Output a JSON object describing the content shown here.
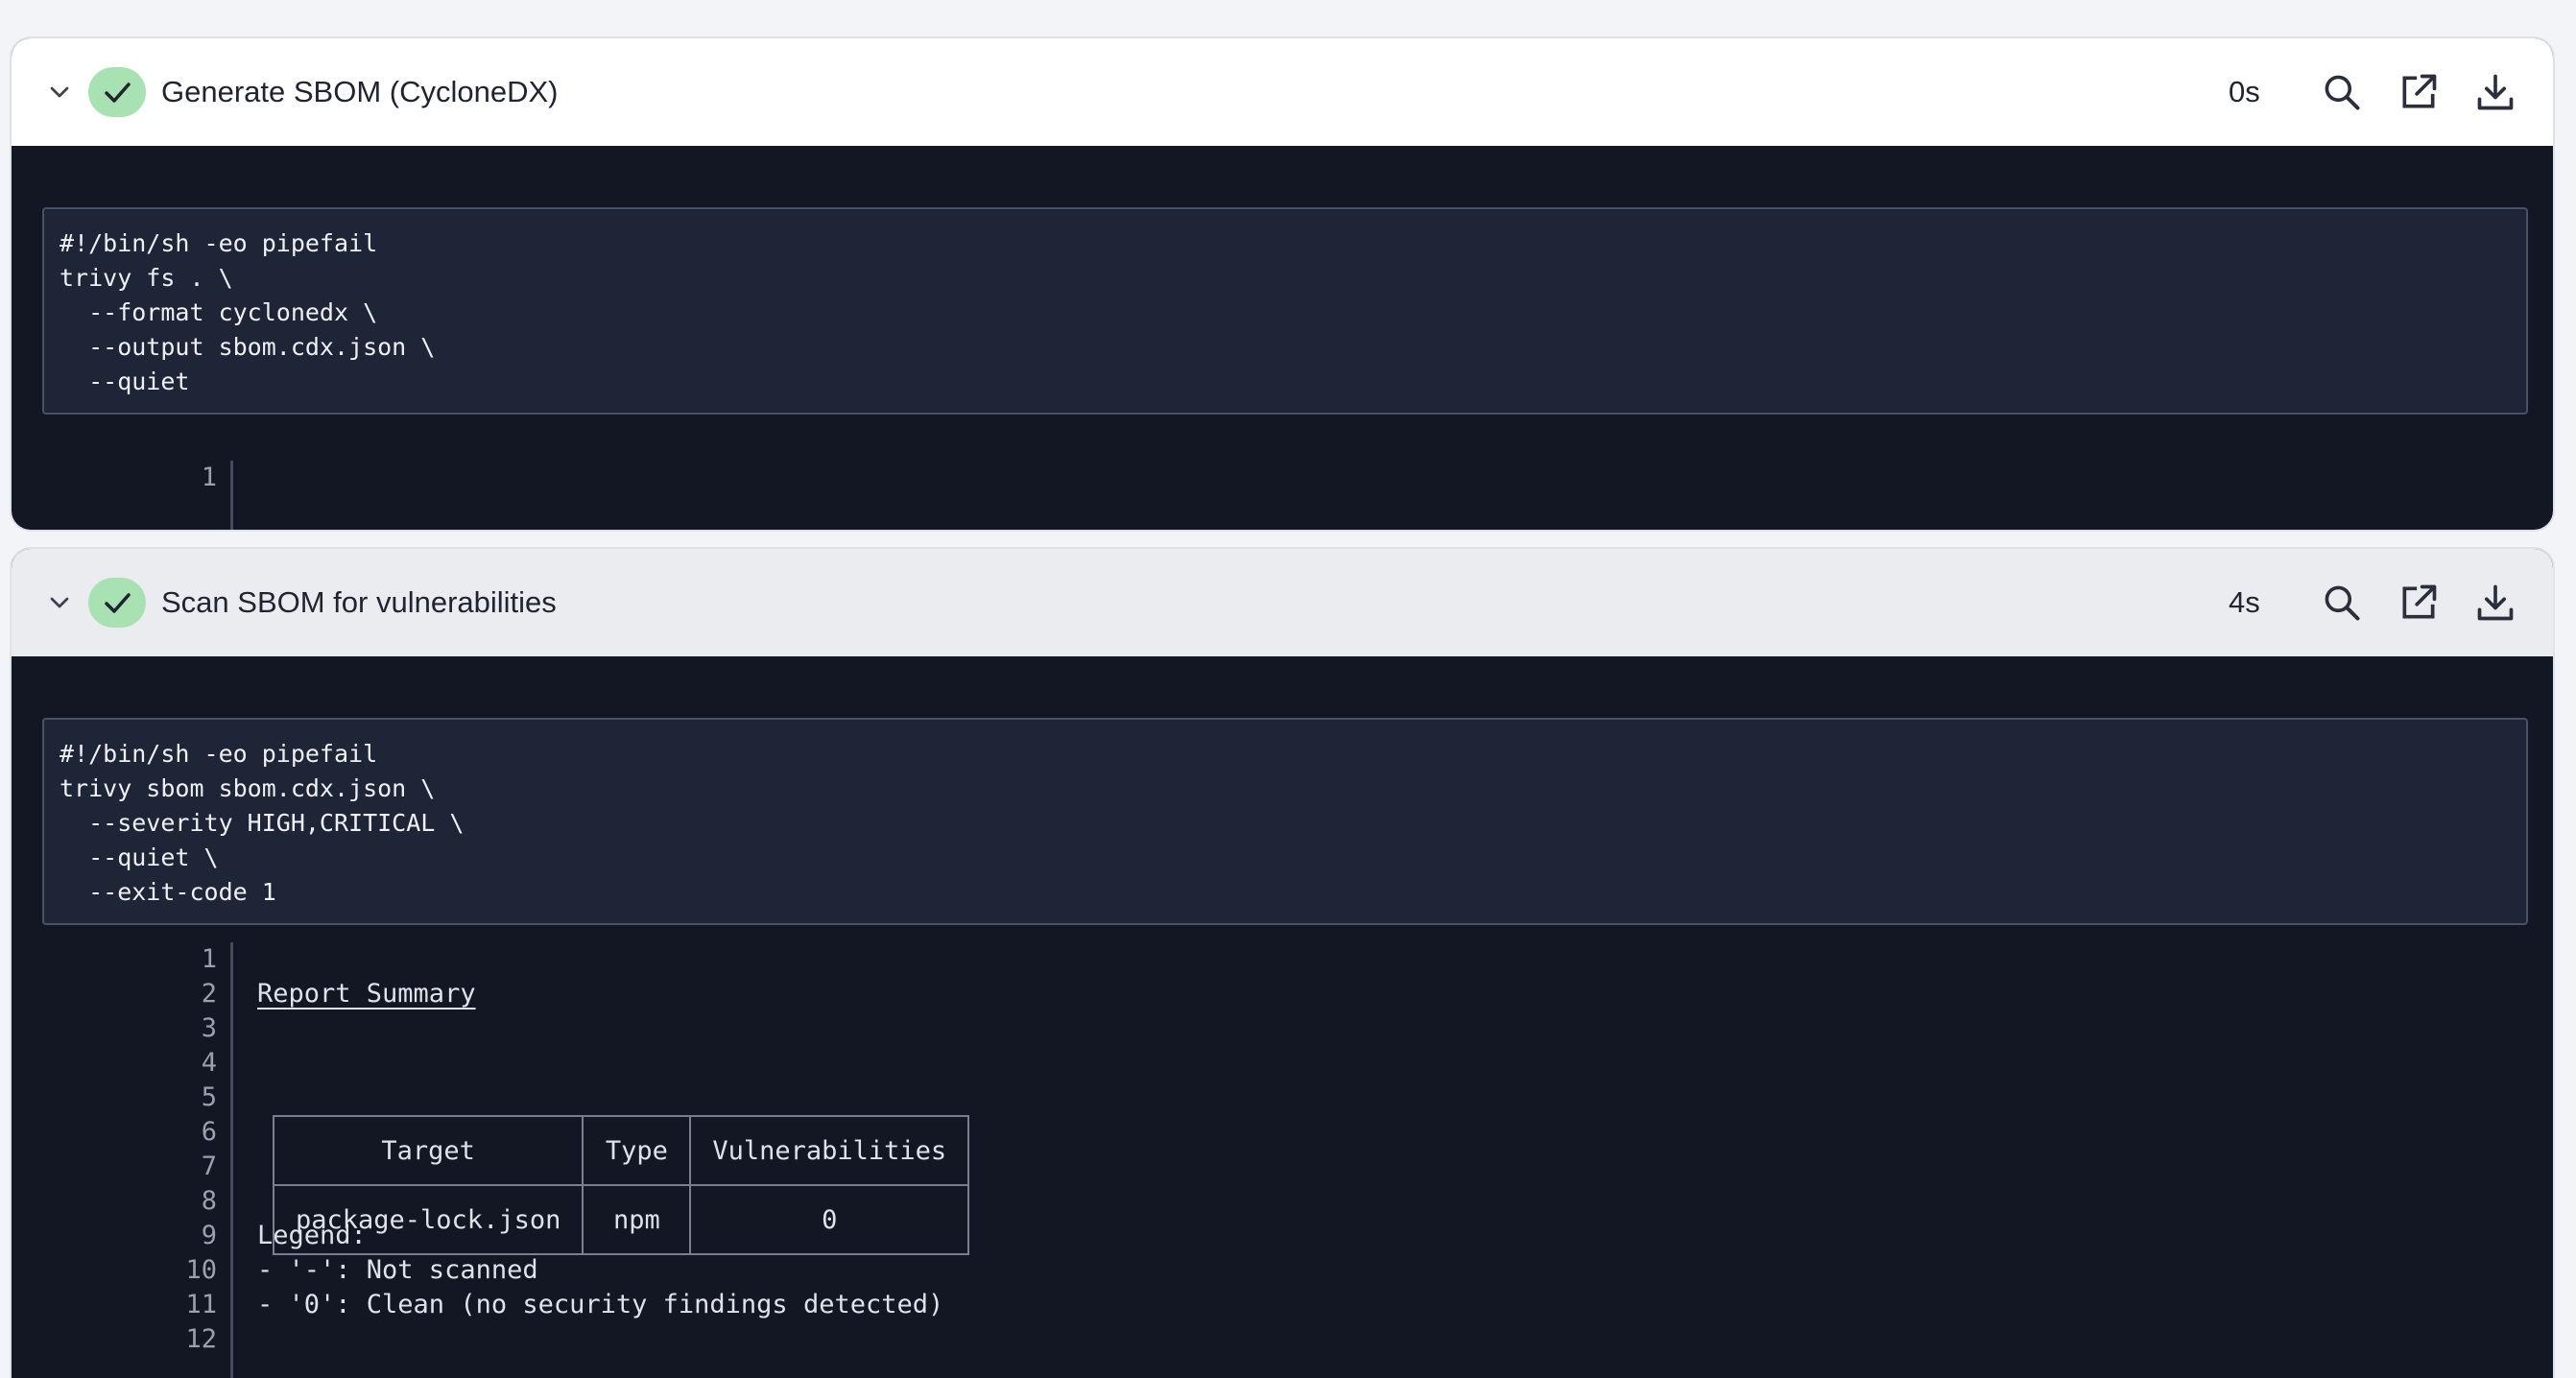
{
  "steps": [
    {
      "title": "Generate SBOM (CycloneDX)",
      "duration": "0s",
      "status": "success",
      "script": [
        "#!/bin/sh -eo pipefail",
        "trivy fs . \\",
        "  --format cyclonedx \\",
        "  --output sbom.cdx.json \\",
        "  --quiet"
      ],
      "log_line_numbers": [
        "1"
      ]
    },
    {
      "title": "Scan SBOM for vulnerabilities",
      "duration": "4s",
      "status": "success",
      "script": [
        "#!/bin/sh -eo pipefail",
        "trivy sbom sbom.cdx.json \\",
        "  --severity HIGH,CRITICAL \\",
        "  --quiet \\",
        "  --exit-code 1"
      ],
      "log_line_numbers": [
        "1",
        "2",
        "3",
        "4",
        "5",
        "6",
        "7",
        "8",
        "9",
        "10",
        "11",
        "12"
      ],
      "log_text": {
        "report_title": "Report Summary",
        "legend_title": "Legend:",
        "legend_not_scanned": "- '-': Not scanned",
        "legend_clean": "- '0': Clean (no security findings detected)"
      },
      "summary_table": {
        "headers": [
          "Target",
          "Type",
          "Vulnerabilities"
        ],
        "rows": [
          [
            "package-lock.json",
            "npm",
            "0"
          ]
        ]
      }
    }
  ],
  "icons": {
    "collapse": "chevron-down-icon",
    "status": "check-icon",
    "search": "search-icon",
    "open": "external-link-icon",
    "download": "download-icon"
  },
  "colors": {
    "success_badge": "#a8e2b3",
    "terminal_bg": "#121723",
    "script_bg": "#1e2536"
  }
}
